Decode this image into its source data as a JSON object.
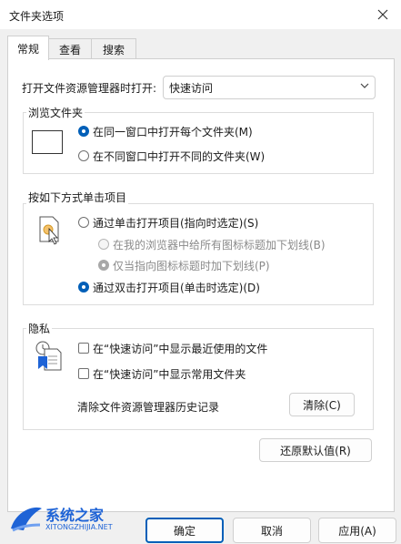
{
  "window": {
    "title": "文件夹选项"
  },
  "tabs": [
    {
      "label": "常规"
    },
    {
      "label": "查看"
    },
    {
      "label": "搜索"
    }
  ],
  "open_explorer": {
    "label": "打开文件资源管理器时打开:",
    "value": "快速访问"
  },
  "browse": {
    "title": "浏览文件夹",
    "options": [
      {
        "label": "在同一窗口中打开每个文件夹(M)"
      },
      {
        "label": "在不同窗口中打开不同的文件夹(W)"
      }
    ]
  },
  "click": {
    "title": "按如下方式单击项目",
    "single": "通过单击打开项目(指向时选定)(S)",
    "underline_always": "在我的浏览器中给所有图标标题加下划线(B)",
    "underline_hover": "仅当指向图标标题时加下划线(P)",
    "double": "通过双击打开项目(单击时选定)(D)"
  },
  "privacy": {
    "title": "隐私",
    "show_recent": "在“快速访问”中显示最近使用的文件",
    "show_frequent": "在“快速访问”中显示常用文件夹",
    "clear_label": "清除文件资源管理器历史记录",
    "clear_button": "清除(C)"
  },
  "restore_defaults": "还原默认值(R)",
  "footer": {
    "ok": "确定",
    "cancel": "取消",
    "apply": "应用(A)"
  },
  "watermark": {
    "brand": "系统之家",
    "url": "XITONGZHIJIA.NET"
  },
  "colors": {
    "accent": "#005fb8",
    "watermark_blue": "#1e63d6"
  }
}
